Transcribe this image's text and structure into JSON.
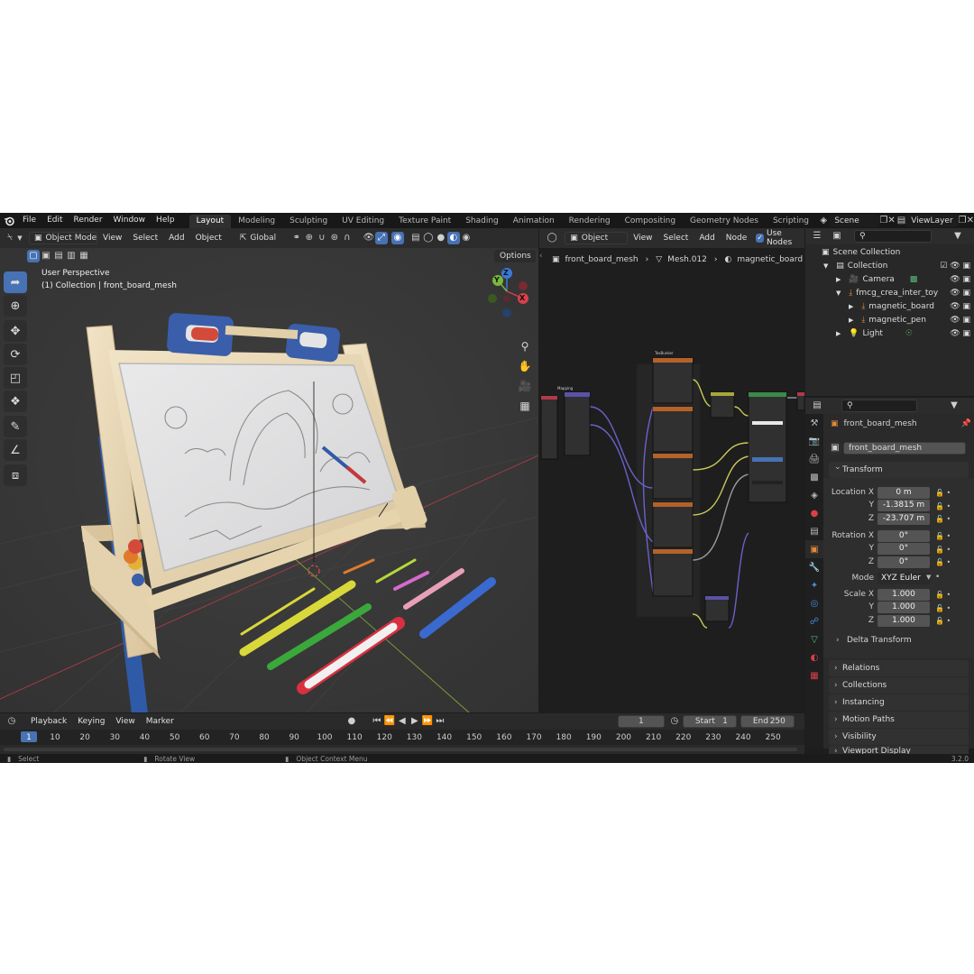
{
  "topbar": {
    "menus": [
      "File",
      "Edit",
      "Render",
      "Window",
      "Help"
    ],
    "workspaces": [
      "Layout",
      "Modeling",
      "Sculpting",
      "UV Editing",
      "Texture Paint",
      "Shading",
      "Animation",
      "Rendering",
      "Compositing",
      "Geometry Nodes",
      "Scripting"
    ],
    "active_workspace": "Layout",
    "scene": "Scene",
    "view_layer": "ViewLayer"
  },
  "viewport": {
    "mode": "Object Mode",
    "menus": [
      "View",
      "Select",
      "Add",
      "Object"
    ],
    "orientation": "Global",
    "options": "Options",
    "overlay_title": "User Perspective",
    "overlay_subtitle": "(1) Collection | front_board_mesh",
    "gizmo": {
      "z": "Z",
      "y": "Y",
      "x": "X"
    }
  },
  "node_editor": {
    "type": "Object",
    "menus": [
      "View",
      "Select",
      "Add",
      "Node"
    ],
    "use_nodes": "Use Nodes",
    "breadcrumb": [
      "front_board_mesh",
      "Mesh.012",
      "magnetic_board"
    ],
    "nodes": {
      "mapping": "Mapping",
      "texture": "TexBunker"
    }
  },
  "outliner": {
    "root": "Scene Collection",
    "items": [
      {
        "label": "Collection",
        "indent": 1
      },
      {
        "label": "Camera",
        "indent": 2
      },
      {
        "label": "fmcg_crea_inter_toy",
        "indent": 2
      },
      {
        "label": "magnetic_board",
        "indent": 3
      },
      {
        "label": "magnetic_pen",
        "indent": 3
      },
      {
        "label": "Light",
        "indent": 2
      }
    ]
  },
  "properties": {
    "object_name": "front_board_mesh",
    "data_name": "front_board_mesh",
    "transform": {
      "title": "Transform",
      "location_label": "Location X",
      "location": [
        "0 m",
        "-1.3815 m",
        "-23.707 m"
      ],
      "rotation_label": "Rotation X",
      "rotation": [
        "0°",
        "0°",
        "0°"
      ],
      "mode_label": "Mode",
      "mode": "XYZ Euler",
      "scale_label": "Scale X",
      "scale": [
        "1.000",
        "1.000",
        "1.000"
      ],
      "axes": [
        "Y",
        "Z"
      ],
      "delta": "Delta Transform"
    },
    "panels": [
      "Relations",
      "Collections",
      "Instancing",
      "Motion Paths",
      "Visibility",
      "Viewport Display"
    ]
  },
  "timeline": {
    "menus": [
      "Playback",
      "Keying",
      "View",
      "Marker"
    ],
    "current_frame": "1",
    "start_label": "Start",
    "start": "1",
    "end_label": "End",
    "end": "250",
    "ruler": [
      "1",
      "10",
      "20",
      "30",
      "40",
      "50",
      "60",
      "70",
      "80",
      "90",
      "100",
      "110",
      "120",
      "130",
      "140",
      "150",
      "160",
      "170",
      "180",
      "190",
      "200",
      "210",
      "220",
      "230",
      "240",
      "250"
    ]
  },
  "statusbar": {
    "select": "Select",
    "rotate": "Rotate View",
    "context": "Object Context Menu",
    "version": "3.2.0"
  }
}
